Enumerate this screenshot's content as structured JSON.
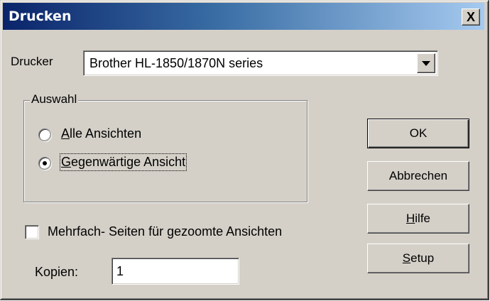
{
  "window": {
    "title": "Drucken",
    "close_label": "X"
  },
  "printer": {
    "label": "Drucker",
    "selected": "Brother HL-1850/1870N series"
  },
  "selection": {
    "group_label": "Auswahl",
    "options": [
      {
        "label_hotkey": "A",
        "label_rest": "lle Ansichten",
        "checked": false
      },
      {
        "label_hotkey": "G",
        "label_rest": "egenwärtige Ansicht",
        "checked": true
      }
    ]
  },
  "multipage": {
    "label": "Mehrfach- Seiten für gezoomte Ansichten",
    "checked": false
  },
  "copies": {
    "label": "Kopien:",
    "value": "1"
  },
  "buttons": {
    "ok": "OK",
    "cancel": "Abbrechen",
    "help_hotkey": "H",
    "help_rest": "ilfe",
    "setup_hotkey": "S",
    "setup_rest": "etup"
  },
  "colors": {
    "titlebar_start": "#0a246a",
    "titlebar_end": "#a6caf0",
    "face": "#d4d0c8"
  }
}
